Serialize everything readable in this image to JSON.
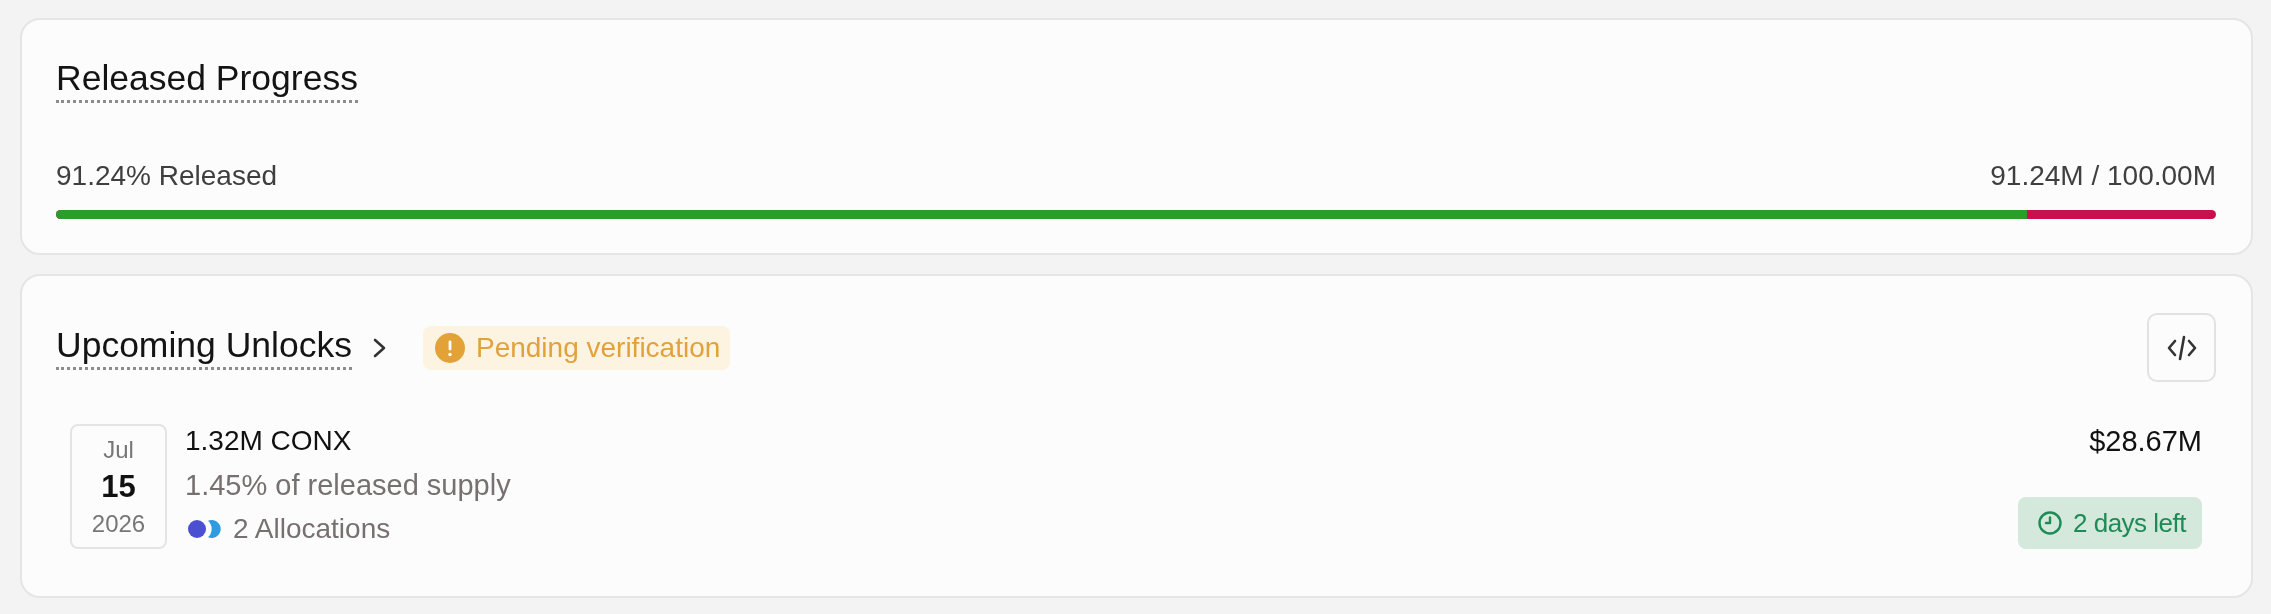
{
  "released_progress": {
    "title": "Released Progress",
    "percent_label": "91.24% Released",
    "amount_label": "91.24M / 100.00M",
    "level": 0.9124
  },
  "upcoming_unlocks": {
    "title": "Upcoming Unlocks",
    "status_badge": "Pending verification",
    "unlocks": [
      {
        "date": {
          "month": "Jul",
          "day": "15",
          "year": "2026"
        },
        "amount": "1.32M CONX",
        "share": "1.45% of released supply",
        "allocation_dots": [
          {
            "color": "#4b4fd1"
          },
          {
            "color": "#2f9be0"
          }
        ],
        "allocations": "2 Allocations",
        "value": "$28.67M",
        "time_left": "2 days left"
      }
    ]
  }
}
